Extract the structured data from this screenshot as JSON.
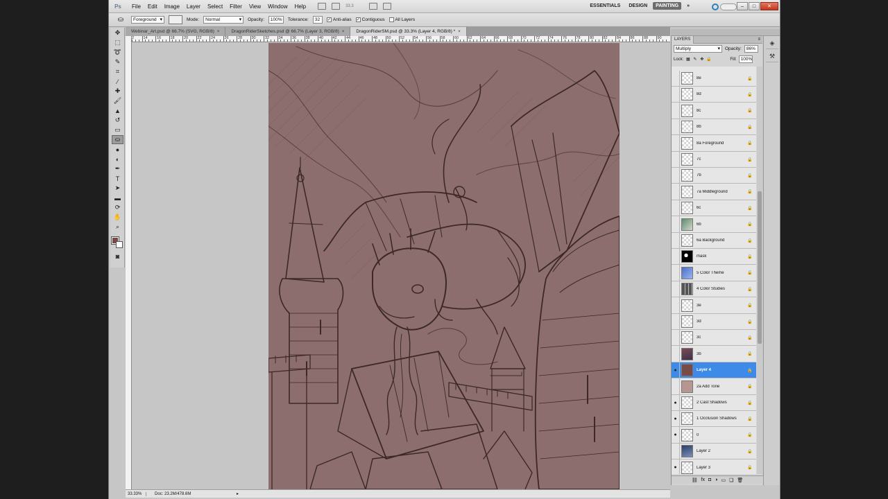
{
  "app": {
    "logo": "Ps",
    "menus": [
      "File",
      "Edit",
      "Image",
      "Layer",
      "Select",
      "Filter",
      "View",
      "Window",
      "Help"
    ],
    "zoom_field": "33.3",
    "workspaces": [
      "ESSENTIALS",
      "DESIGN",
      "PAINTING"
    ],
    "active_workspace": "PAINTING",
    "more": "»"
  },
  "options": {
    "fill_source": "Foreground",
    "mode_label": "Mode:",
    "mode_value": "Normal",
    "opacity_label": "Opacity:",
    "opacity_value": "100%",
    "tolerance_label": "Tolerance:",
    "tolerance_value": "32",
    "anti_alias": "Anti-alias",
    "contiguous": "Contiguous",
    "all_layers": "All Layers"
  },
  "tabs": [
    {
      "label": "Webinar_Art.psd @ 66.7% (SVG, RGB/8)",
      "active": false
    },
    {
      "label": "DragonRiderSketches.psd @ 66.7% (Layer 3, RGB/8)",
      "active": false
    },
    {
      "label": "DragonRiderSM.psd @ 33.3% (Layer 4, RGB/8) *",
      "active": true
    }
  ],
  "rulers": {
    "top_numbers": [
      "12",
      "14",
      "16",
      "18",
      "20",
      "22",
      "24",
      "26",
      "28",
      "30",
      "32",
      "34",
      "36",
      "38",
      "40",
      "42",
      "44",
      "46",
      "48",
      "50",
      "52",
      "54",
      "56",
      "58",
      "60",
      "62",
      "64",
      "66",
      "68",
      "70",
      "72",
      "74",
      "76",
      "78",
      "80",
      "82",
      "84",
      "86",
      "88",
      "90"
    ]
  },
  "status": {
    "zoom": "33.33%",
    "doc": "Doc: 23.2M/478.6M"
  },
  "layers_panel": {
    "tab_label": "LAYERS",
    "blend_mode": "Multiply",
    "opacity_label": "Opacity:",
    "opacity_value": "86%",
    "lock_label": "Lock:",
    "fill_label": "Fill:",
    "fill_value": "100%",
    "layers": [
      {
        "name": "8e",
        "visible": false,
        "thumb": "checker"
      },
      {
        "name": "8d",
        "visible": false,
        "thumb": "checker"
      },
      {
        "name": "8c",
        "visible": false,
        "thumb": "checker"
      },
      {
        "name": "8b",
        "visible": false,
        "thumb": "checker"
      },
      {
        "name": "8a Foreground",
        "visible": false,
        "thumb": "checker"
      },
      {
        "name": "7c",
        "visible": false,
        "thumb": "checker"
      },
      {
        "name": "7b",
        "visible": false,
        "thumb": "checker"
      },
      {
        "name": "7a Middleground",
        "visible": false,
        "thumb": "checker"
      },
      {
        "name": "6c",
        "visible": false,
        "thumb": "checker"
      },
      {
        "name": "6b",
        "visible": false,
        "thumb": "green"
      },
      {
        "name": "6a Background",
        "visible": false,
        "thumb": "checker"
      },
      {
        "name": "mask",
        "visible": false,
        "thumb": "mask"
      },
      {
        "name": "5 Color Theme",
        "visible": false,
        "thumb": "blue"
      },
      {
        "name": "4 Color Studies",
        "visible": false,
        "thumb": "studies"
      },
      {
        "name": "3e",
        "visible": false,
        "thumb": "checker"
      },
      {
        "name": "3d",
        "visible": false,
        "thumb": "checker"
      },
      {
        "name": "3c",
        "visible": false,
        "thumb": "checker"
      },
      {
        "name": "3b",
        "visible": false,
        "thumb": "painted"
      },
      {
        "name": "Layer 4",
        "visible": true,
        "thumb": "brown",
        "selected": true
      },
      {
        "name": "2a Add Tone",
        "visible": false,
        "thumb": "tone"
      },
      {
        "name": "2 Cast Shadows",
        "visible": true,
        "thumb": "checker"
      },
      {
        "name": "1 Occlusion Shadows",
        "visible": true,
        "thumb": "checker"
      },
      {
        "name": "0",
        "visible": true,
        "thumb": "checker"
      },
      {
        "name": "Layer 2",
        "visible": false,
        "thumb": "dark"
      },
      {
        "name": "Layer 3",
        "visible": true,
        "thumb": "checker"
      }
    ],
    "footer_icons": [
      "link-icon",
      "fx-icon",
      "mask-icon",
      "adjustment-icon",
      "group-icon",
      "new-layer-icon",
      "trash-icon"
    ]
  },
  "colors": {
    "foreground": "#7a4b46",
    "background": "#ffffff",
    "artwork_tone": "#8b6e6d",
    "selected_layer": "#3d8ae8"
  }
}
